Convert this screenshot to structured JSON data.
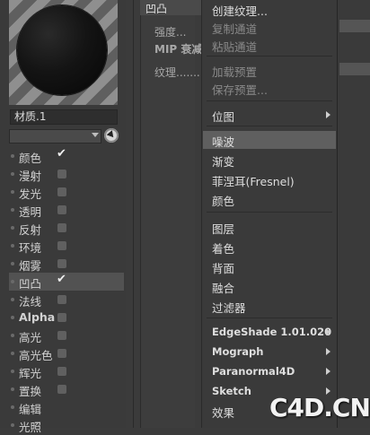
{
  "material": {
    "name": "材质.1",
    "channels": [
      {
        "label": "颜色",
        "checked": true
      },
      {
        "label": "漫射",
        "checked": false
      },
      {
        "label": "发光",
        "checked": false
      },
      {
        "label": "透明",
        "checked": false
      },
      {
        "label": "反射",
        "checked": false
      },
      {
        "label": "环境",
        "checked": false
      },
      {
        "label": "烟雾",
        "checked": false
      },
      {
        "label": "凹凸",
        "checked": true,
        "selected": true
      },
      {
        "label": "法线",
        "checked": false
      },
      {
        "label": "Alpha",
        "checked": false
      },
      {
        "label": "高光",
        "checked": false
      },
      {
        "label": "高光色",
        "checked": false
      },
      {
        "label": "辉光",
        "checked": false
      },
      {
        "label": "置换",
        "checked": false
      },
      {
        "label": "编辑",
        "checked": null
      },
      {
        "label": "光照",
        "checked": null
      }
    ]
  },
  "attributes": {
    "header": "凹凸",
    "strength_label": "强度",
    "mip_label": "MIP 衰减",
    "texture_label": "纹理"
  },
  "menu": {
    "items": [
      {
        "label": "创建纹理...",
        "disabled": false
      },
      {
        "label": "复制通道",
        "disabled": true
      },
      {
        "label": "粘贴通道",
        "disabled": true
      },
      {
        "label": "加载预置",
        "disabled": true
      },
      {
        "label": "保存预置...",
        "disabled": true
      },
      {
        "label": "位图",
        "submenu": true
      },
      {
        "label": "噪波",
        "highlighted": true
      },
      {
        "label": "渐变"
      },
      {
        "label": "菲涅耳(Fresnel)"
      },
      {
        "label": "颜色"
      },
      {
        "label": "图层"
      },
      {
        "label": "着色"
      },
      {
        "label": "背面"
      },
      {
        "label": "融合"
      },
      {
        "label": "过滤器"
      },
      {
        "label": "EdgeShade 1.01.020",
        "submenu": true
      },
      {
        "label": "Mograph",
        "submenu": true
      },
      {
        "label": "Paranormal4D",
        "submenu": true
      },
      {
        "label": "Sketch",
        "submenu": true
      },
      {
        "label": "效果"
      }
    ]
  },
  "watermark": "C4D.CN"
}
